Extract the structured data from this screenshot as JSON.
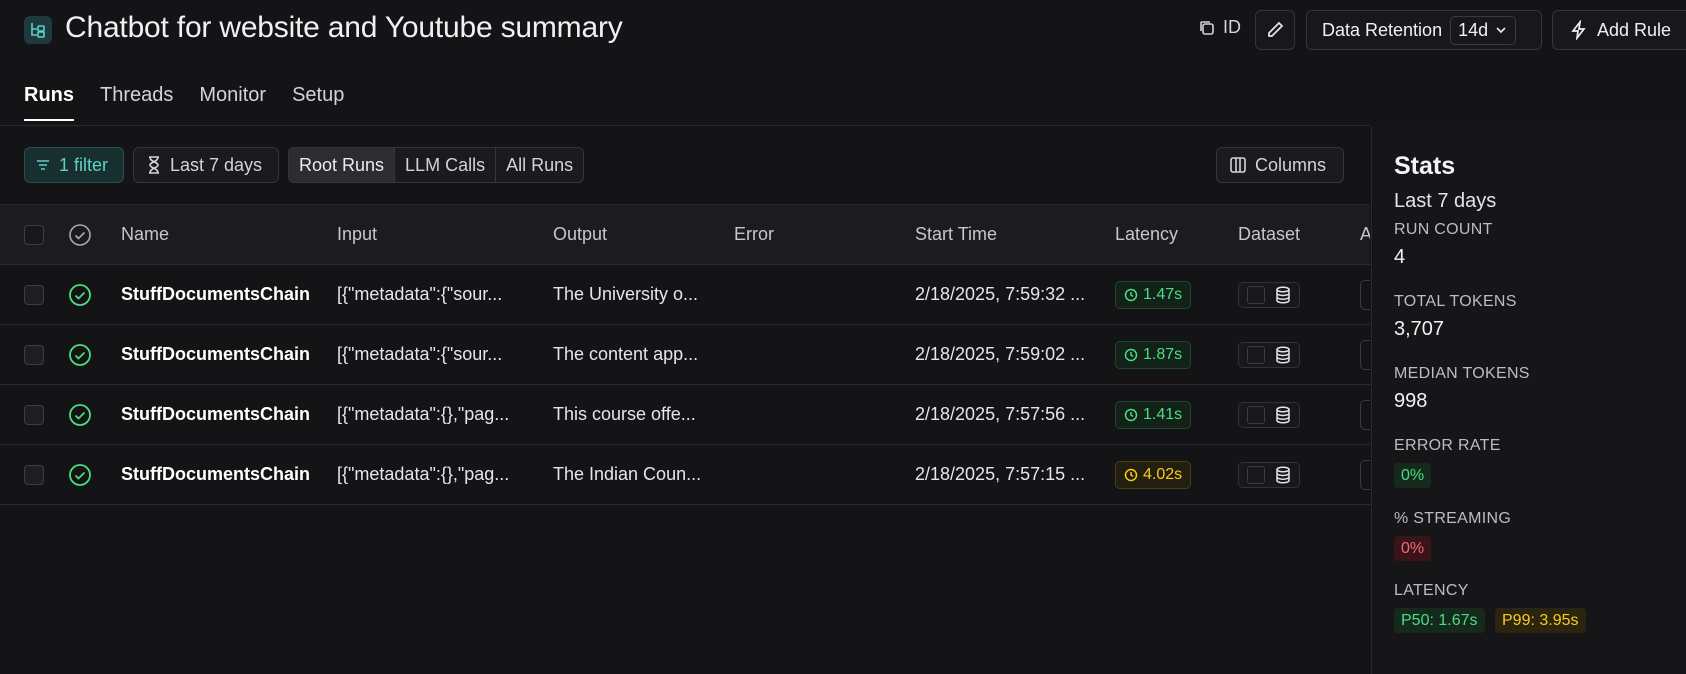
{
  "header": {
    "title": "Chatbot for website and Youtube summary",
    "id_label": "ID",
    "retention_label": "Data Retention",
    "retention_value": "14d",
    "add_rule_label": "Add Rule"
  },
  "tabs": [
    {
      "label": "Runs",
      "active": true
    },
    {
      "label": "Threads",
      "active": false
    },
    {
      "label": "Monitor",
      "active": false
    },
    {
      "label": "Setup",
      "active": false
    }
  ],
  "toolbar": {
    "filter_label": "1 filter",
    "date_label": "Last 7 days",
    "run_types": [
      "Root Runs",
      "LLM Calls",
      "All Runs"
    ],
    "run_type_selected": "Root Runs",
    "columns_label": "Columns"
  },
  "table": {
    "headers": {
      "name": "Name",
      "input": "Input",
      "output": "Output",
      "error": "Error",
      "start_time": "Start Time",
      "latency": "Latency",
      "dataset": "Dataset",
      "more": "A"
    },
    "rows": [
      {
        "name": "StuffDocumentsChain",
        "input": "[{\"metadata\":{\"sour...",
        "output": "The University o...",
        "error": "",
        "start_time": "2/18/2025, 7:59:32 ...",
        "latency": "1.47s",
        "latency_status": "fast"
      },
      {
        "name": "StuffDocumentsChain",
        "input": "[{\"metadata\":{\"sour...",
        "output": "The content app...",
        "error": "",
        "start_time": "2/18/2025, 7:59:02 ...",
        "latency": "1.87s",
        "latency_status": "fast"
      },
      {
        "name": "StuffDocumentsChain",
        "input": "[{\"metadata\":{},\"pag...",
        "output": "This course offe...",
        "error": "",
        "start_time": "2/18/2025, 7:57:56 ...",
        "latency": "1.41s",
        "latency_status": "fast"
      },
      {
        "name": "StuffDocumentsChain",
        "input": "[{\"metadata\":{},\"pag...",
        "output": "The Indian Coun...",
        "error": "",
        "start_time": "2/18/2025, 7:57:15 ...",
        "latency": "4.02s",
        "latency_status": "slow"
      }
    ]
  },
  "stats": {
    "title": "Stats",
    "period": "Last 7 days",
    "run_count_label": "RUN COUNT",
    "run_count": "4",
    "total_tokens_label": "TOTAL TOKENS",
    "total_tokens": "3,707",
    "median_tokens_label": "MEDIAN TOKENS",
    "median_tokens": "998",
    "error_rate_label": "ERROR RATE",
    "error_rate": "0%",
    "streaming_label": "% STREAMING",
    "streaming": "0%",
    "latency_label": "LATENCY",
    "p50": "P50: 1.67s",
    "p99": "P99: 3.95s"
  },
  "colors": {
    "accent_teal": "#5fd0c4",
    "success_green": "#4ade80",
    "warning_yellow": "#facc15",
    "danger_red": "#f26a7a",
    "background": "#141416"
  }
}
